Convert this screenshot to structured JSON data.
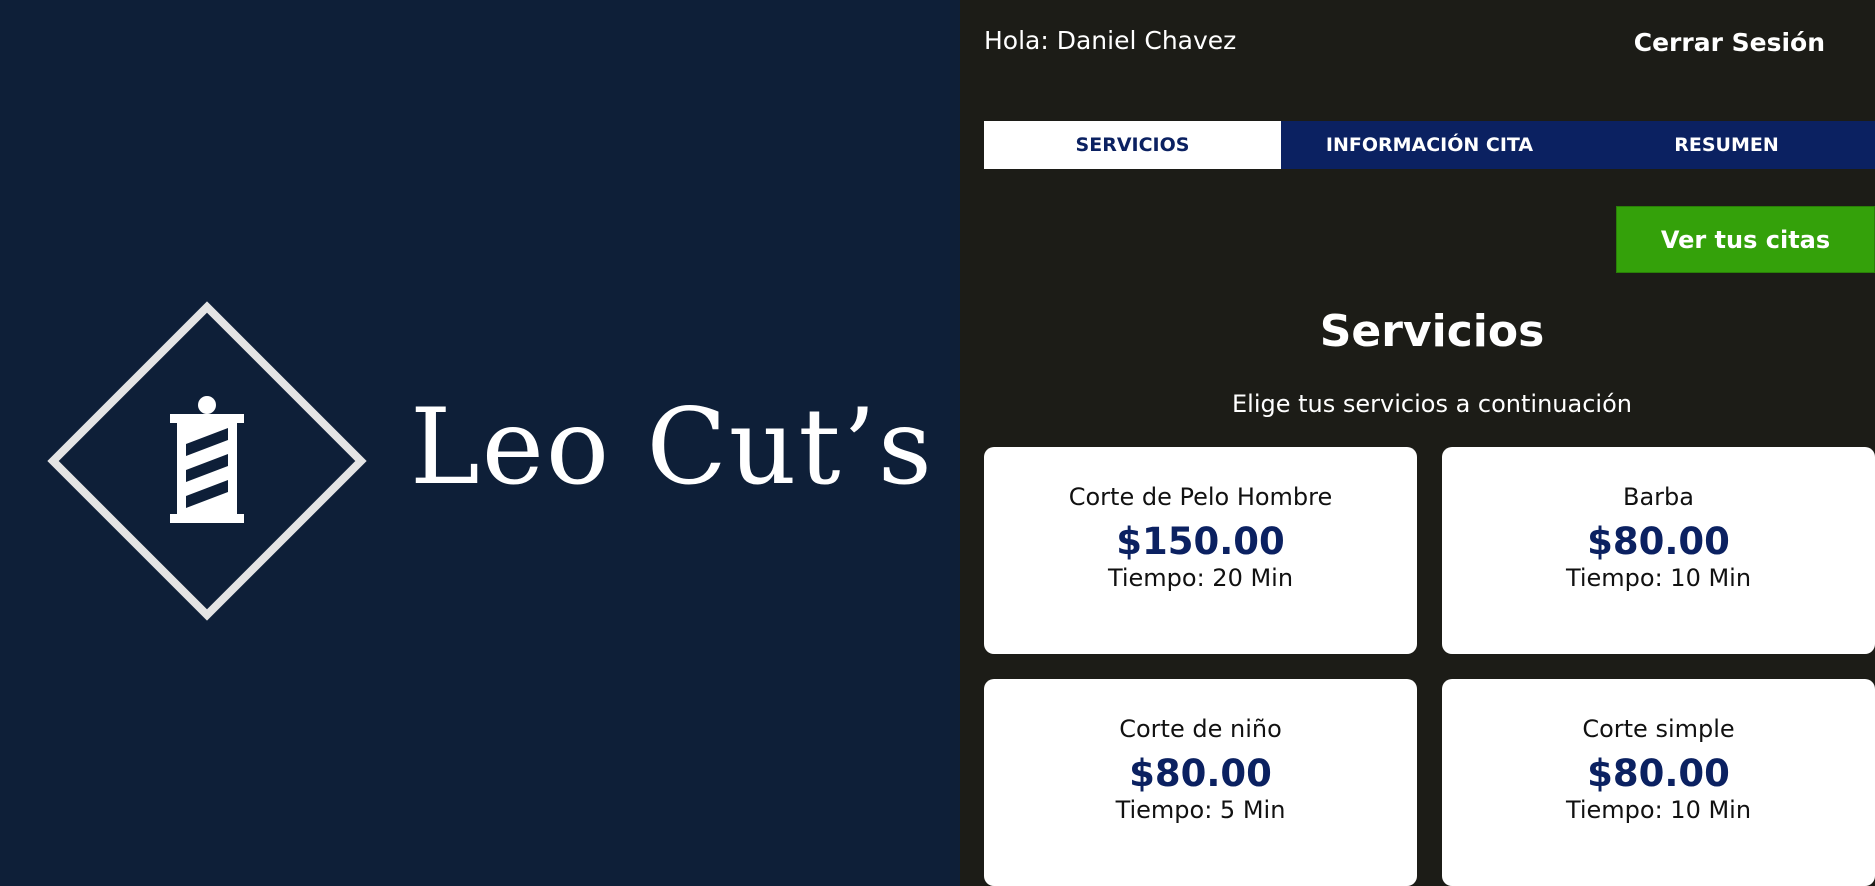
{
  "brand": {
    "name": "Leo Cut’s"
  },
  "header": {
    "greeting": "Hola: Daniel Chavez",
    "logout_label": "Cerrar Sesión"
  },
  "tabs": [
    {
      "label": "SERVICIOS",
      "active": true
    },
    {
      "label": "INFORMACIÓN CITA",
      "active": false
    },
    {
      "label": "RESUMEN",
      "active": false
    }
  ],
  "actions": {
    "view_appointments_label": "Ver tus citas"
  },
  "section": {
    "title": "Servicios",
    "subtitle": "Elige tus servicios a continuación"
  },
  "services": [
    {
      "name": "Corte de Pelo Hombre",
      "price": "$150.00",
      "time": "Tiempo: 20 Min"
    },
    {
      "name": "Barba",
      "price": "$80.00",
      "time": "Tiempo: 10 Min"
    },
    {
      "name": "Corte de niño",
      "price": "$80.00",
      "time": "Tiempo: 5 Min"
    },
    {
      "name": "Corte simple",
      "price": "$80.00",
      "time": "Tiempo: 10 Min"
    }
  ],
  "colors": {
    "left_background": "#0e1f38",
    "right_background": "#1c1c17",
    "tab_active_background": "#ffffff",
    "tab_background": "#0b2161",
    "price_color": "#0b2161",
    "button_green": "#34a10a"
  }
}
